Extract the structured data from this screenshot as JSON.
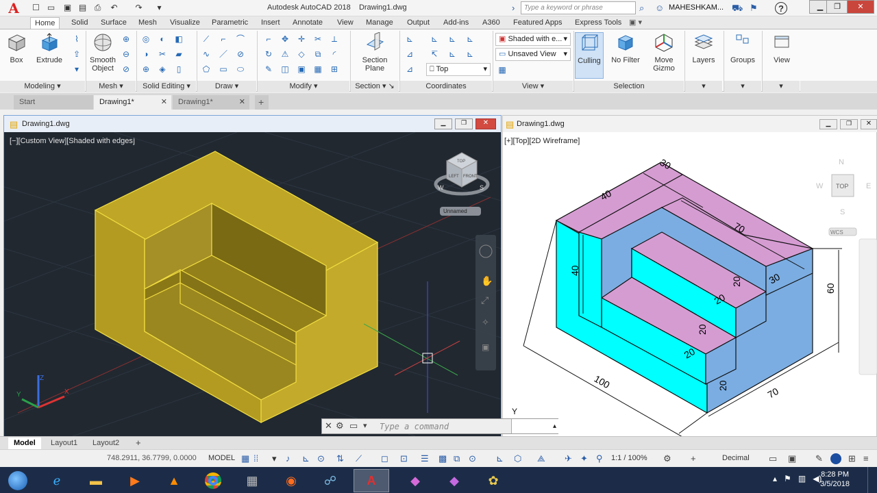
{
  "title_bar": {
    "app_title": "Autodesk AutoCAD 2018",
    "doc_title": "Drawing1.dwg",
    "search_placeholder": "Type a keyword or phrase",
    "user": "MAHESHKAM...",
    "help": "?"
  },
  "ribbon_tabs": [
    "Home",
    "Solid",
    "Surface",
    "Mesh",
    "Visualize",
    "Parametric",
    "Insert",
    "Annotate",
    "View",
    "Manage",
    "Output",
    "Add-ins",
    "A360",
    "Featured Apps",
    "Express Tools"
  ],
  "ribbon": {
    "modeling": {
      "box": "Box",
      "extrude": "Extrude",
      "title": "Modeling"
    },
    "mesh": {
      "smooth_object": "Smooth Object",
      "title": "Mesh"
    },
    "solid_editing": {
      "title": "Solid Editing"
    },
    "draw": {
      "title": "Draw"
    },
    "modify": {
      "title": "Modify"
    },
    "section": {
      "section_plane": "Section Plane",
      "title": "Section"
    },
    "coordinates": {
      "title": "Coordinates"
    },
    "view": {
      "visual_style": "Shaded with e...",
      "named_view": "Unsaved View",
      "view_direction": "Top",
      "title": "View"
    },
    "selection": {
      "culling": "Culling",
      "no_filter": "No Filter",
      "move_gizmo": "Move Gizmo",
      "title": "Selection"
    },
    "layers": "Layers",
    "groups": "Groups",
    "view_panel": "View"
  },
  "doc_tabs": [
    "Start",
    "Drawing1*",
    "Drawing1*"
  ],
  "viewport_left": {
    "title": "Drawing1.dwg",
    "label": "[−][Custom View][Shaded with edges]",
    "named": "Unnamed",
    "cube_faces": [
      "TOP",
      "LEFT",
      "FRONT"
    ]
  },
  "viewport_right": {
    "title": "Drawing1.dwg",
    "label": "[+][Top][2D Wireframe]",
    "compass": {
      "n": "N",
      "s": "S",
      "e": "E",
      "w": "W",
      "top": "TOP"
    },
    "wcs": "WCS",
    "dims": [
      "30",
      "40",
      "70",
      "40",
      "20",
      "30",
      "60",
      "20",
      "20",
      "20",
      "20",
      "100",
      "70"
    ],
    "axis_y": "Y"
  },
  "command_line": {
    "placeholder": "Type a command"
  },
  "layout_tabs": [
    "Model",
    "Layout1",
    "Layout2"
  ],
  "status_bar": {
    "coords": "748.2911, 36.7799, 0.0000",
    "space": "MODEL",
    "scale": "1:1 / 100%",
    "units": "Decimal"
  },
  "taskbar": {
    "time": "8:28 PM",
    "date": "3/5/2018",
    "items": [
      "start-orb-icon",
      "internet-explorer-icon",
      "file-explorer-icon",
      "media-player-icon",
      "vlc-icon",
      "chrome-icon",
      "calculator-icon",
      "firefox-icon",
      "network-tool-icon",
      "autocad-icon",
      "photo-editor-icon",
      "photo-editor-2-icon",
      "paint-icon"
    ]
  },
  "colors": {
    "solid_yellow": "#b8a21e",
    "magenta_face": "#d59cd2",
    "cyan_face": "#00ffff",
    "blue_face": "#7bade2",
    "viewport_dark": "#212830"
  }
}
